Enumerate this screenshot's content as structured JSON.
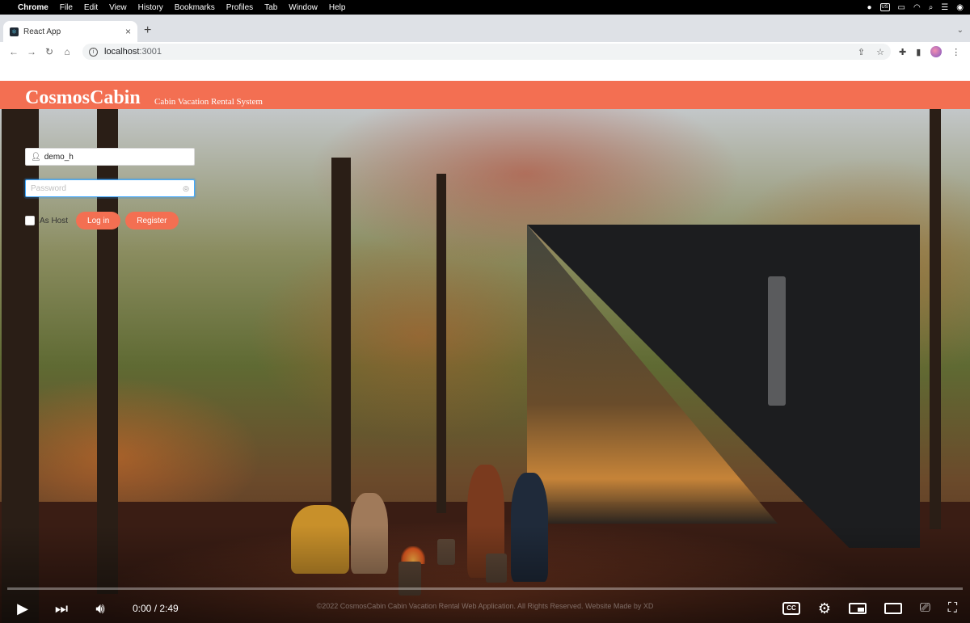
{
  "menubar": {
    "items": [
      "Chrome",
      "File",
      "Edit",
      "View",
      "History",
      "Bookmarks",
      "Profiles",
      "Tab",
      "Window",
      "Help"
    ],
    "status_badge": "US"
  },
  "browser": {
    "tab_title": "React App",
    "url_host": "localhost",
    "url_port": ":3001"
  },
  "header": {
    "brand": "CosmosCabin",
    "tagline": "Cabin Vacation Rental System",
    "color": "#f36f52"
  },
  "login": {
    "username_value": "demo_h",
    "password_placeholder": "Password",
    "checkbox_label": "As Host",
    "login_label": "Log in",
    "register_label": "Register"
  },
  "footer": {
    "text": "©2022 CosmosCabin Cabin Vacation Rental Web Application. All Rights Reserved. Website Made by XD"
  },
  "player": {
    "time_current": "0:00",
    "time_total": "2:49",
    "progress": 0,
    "cc_label": "CC"
  }
}
